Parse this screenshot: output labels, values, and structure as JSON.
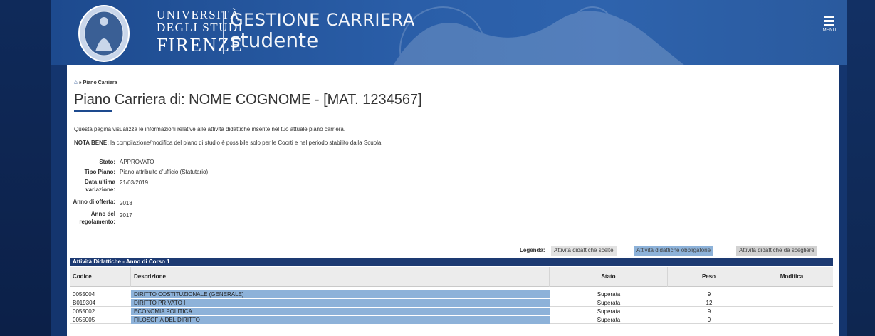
{
  "header": {
    "university_line1": "UNIVERSITÀ",
    "university_line2": "DEGLI STUDI",
    "university_line3": "FIRENZE",
    "app_title_line1": "GESTIONE CARRIERA",
    "app_title_line2": "studente",
    "menu_label": "MENU"
  },
  "breadcrumb": {
    "home_icon": "home-icon",
    "current": "Piano Carriera"
  },
  "page": {
    "title": "Piano Carriera di: NOME COGNOME - [MAT. 1234567]",
    "description": "Questa pagina visualizza le informazioni relative alle attività didattiche inserite nel tuo attuale piano carriera.",
    "note_label": "NOTA BENE:",
    "note_text": " la compilazione/modifica del piano di studio è possibile solo per le Coorti e nel periodo stabilito dalla Scuola."
  },
  "info": {
    "stato_label": "Stato:",
    "stato_value": "APPROVATO",
    "tipo_label": "Tipo Piano:",
    "tipo_value": "Piano attribuito d'ufficio (Statutario)",
    "data_label_1": "Data ultima",
    "data_label_2": "variazione:",
    "data_value": "21/03/2019",
    "offerta_label": "Anno di offerta:",
    "offerta_value": "2018",
    "regol_label_1": "Anno del",
    "regol_label_2": "regolamento:",
    "regol_value": "2017"
  },
  "legend": {
    "label": "Legenda:",
    "items": [
      {
        "label": "Attività didattiche scelte",
        "color": "#e2e2e2"
      },
      {
        "label": "Attività didattiche obbligatorie",
        "color": "#8db2d9"
      },
      {
        "label": "Attività didattiche da scegliere",
        "color": "#d2d2d2"
      }
    ]
  },
  "table": {
    "section_title": "Attività Didattiche - Anno di Corso 1",
    "columns": [
      "Codice",
      "Descrizione",
      "Stato",
      "Peso",
      "Modifica"
    ],
    "rows": [
      {
        "code": "0055004",
        "desc": "DIRITTO COSTITUZIONALE (GENERALE)",
        "status": "Superata",
        "weight": "9"
      },
      {
        "code": "B019304",
        "desc": "DIRITTO PRIVATO I",
        "status": "Superata",
        "weight": "12"
      },
      {
        "code": "0055002",
        "desc": "ECONOMIA POLITICA",
        "status": "Superata",
        "weight": "9"
      },
      {
        "code": "0055005",
        "desc": "FILOSOFIA DEL DIRITTO",
        "status": "Superata",
        "weight": "9"
      }
    ]
  },
  "colors": {
    "header_blue": "#2a5ea8",
    "table_head": "#1d3a72",
    "mandatory_cell": "#8db2d9"
  }
}
